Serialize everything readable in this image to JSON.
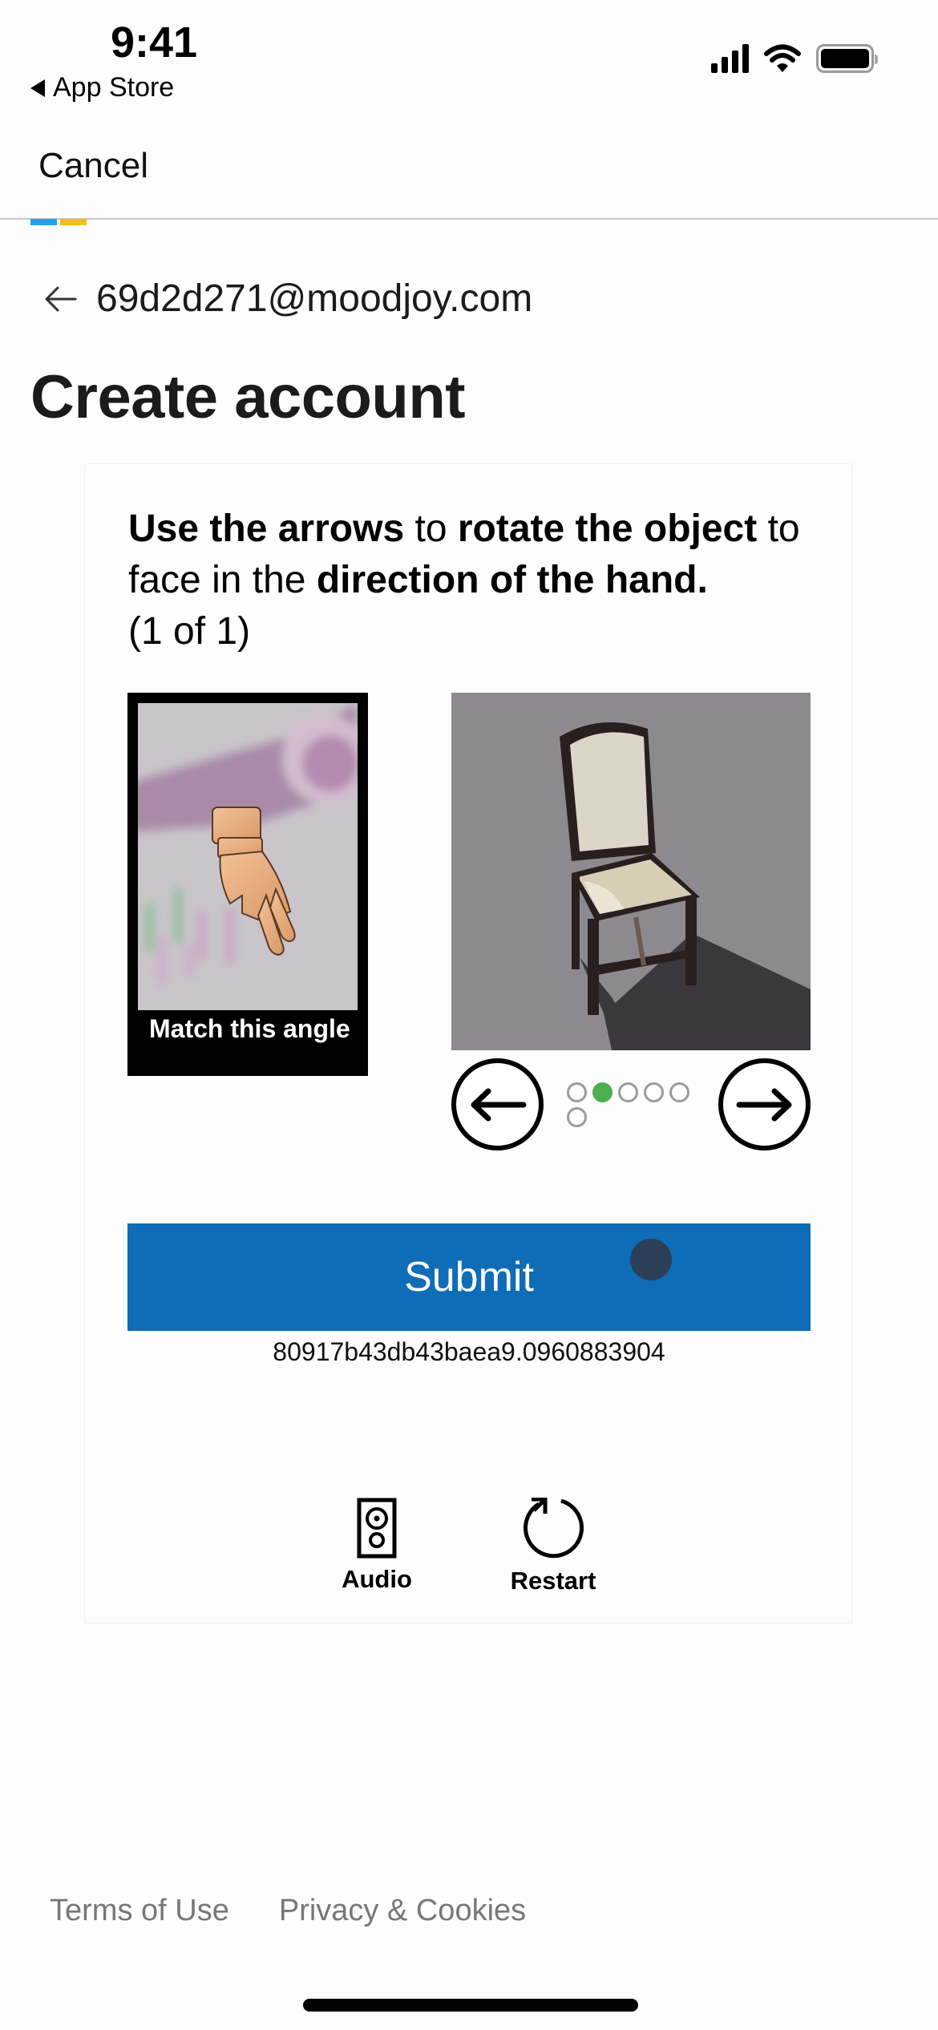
{
  "status_bar": {
    "time": "9:41",
    "back_app": "App Store",
    "icons": [
      "cellular-signal-icon",
      "wifi-icon",
      "battery-icon"
    ]
  },
  "nav": {
    "cancel_label": "Cancel",
    "logo_colors": [
      "#1ea7e6",
      "#f6be1a"
    ],
    "divider_color": "#c8c8c8"
  },
  "identity": {
    "back_icon": "arrow-left-icon",
    "email": "69d2d271@moodjoy.com"
  },
  "page_title": "Create account",
  "challenge": {
    "instruction": {
      "part1_bold": "Use the arrows",
      "part2": " to ",
      "part3_bold": "rotate the object",
      "part4": " to face in the ",
      "part5_bold": "direction of the hand.",
      "progress": "(1 of 1)"
    },
    "reference_image": {
      "label": "Match this angle",
      "description": "hand pointing down-right"
    },
    "object_image": {
      "description": "chair on grey background"
    },
    "prev_arrow_icon": "arrow-left-circle-icon",
    "next_arrow_icon": "arrow-right-circle-icon",
    "pager": {
      "total": 6,
      "active_index": 1,
      "active_color": "#4caf50"
    },
    "submit_label": "Submit",
    "submit_color": "#0f6cb6",
    "session_id": "80917b43db43baea9.0960883904"
  },
  "tools": {
    "audio_label": "Audio",
    "restart_label": "Restart"
  },
  "footer": {
    "terms_label": "Terms of Use",
    "privacy_label": "Privacy & Cookies"
  }
}
